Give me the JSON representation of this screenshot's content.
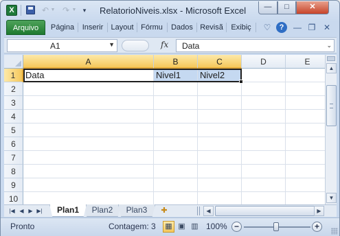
{
  "window": {
    "title": "RelatorioNiveis.xlsx  -  Microsoft Excel",
    "app_icon_letter": "X"
  },
  "ribbon": {
    "file_tab": "Arquivo",
    "tabs": [
      "Página",
      "Inserir",
      "Layout",
      "Fórmu",
      "Dados",
      "Revisã",
      "Exibiç"
    ]
  },
  "formula_bar": {
    "name_box": "A1",
    "fx_label": "fx",
    "content": "Data"
  },
  "grid": {
    "columns": [
      "A",
      "B",
      "C",
      "D",
      "E"
    ],
    "rows": [
      "1",
      "2",
      "3",
      "4",
      "5",
      "6",
      "7",
      "8",
      "9",
      "10"
    ],
    "cells": {
      "A1": "Data",
      "B1": "Nivel1",
      "C1": "Nivel2"
    },
    "selection": "A1:C1"
  },
  "sheets": {
    "tabs": [
      "Plan1",
      "Plan2",
      "Plan3"
    ],
    "active": "Plan1"
  },
  "status": {
    "mode": "Pronto",
    "count": "Contagem: 3",
    "zoom": "100%"
  },
  "colors": {
    "file_tab": "#1f7a30",
    "selection_header": "#f5c85c",
    "selection_fill": "#c5d9f1"
  }
}
